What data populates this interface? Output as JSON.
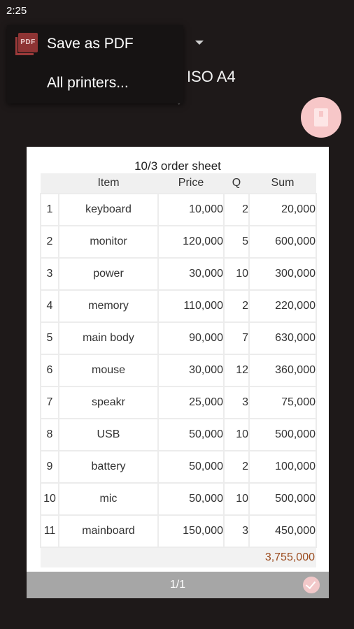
{
  "status_bar": {
    "time": "2:25"
  },
  "print_options": {
    "paper_size": "ISO A4"
  },
  "printer_menu": {
    "items": [
      {
        "label": "Save as PDF",
        "icon": "pdf-icon"
      },
      {
        "label": "All printers..."
      }
    ]
  },
  "fab": {
    "icon": "pdf-download-icon",
    "color": "#f7c7c8"
  },
  "preview": {
    "title": "10/3 order sheet",
    "headers": [
      "",
      "Item",
      "Price",
      "Q",
      "Sum"
    ],
    "rows": [
      [
        "1",
        "keyboard",
        "10,000",
        "2",
        "20,000"
      ],
      [
        "2",
        "monitor",
        "120,000",
        "5",
        "600,000"
      ],
      [
        "3",
        "power",
        "30,000",
        "10",
        "300,000"
      ],
      [
        "4",
        "memory",
        "110,000",
        "2",
        "220,000"
      ],
      [
        "5",
        "main body",
        "90,000",
        "7",
        "630,000"
      ],
      [
        "6",
        "mouse",
        "30,000",
        "12",
        "360,000"
      ],
      [
        "7",
        "speakr",
        "25,000",
        "3",
        "75,000"
      ],
      [
        "8",
        "USB",
        "50,000",
        "10",
        "500,000"
      ],
      [
        "9",
        "battery",
        "50,000",
        "2",
        "100,000"
      ],
      [
        "10",
        "mic",
        "50,000",
        "10",
        "500,000"
      ],
      [
        "11",
        "mainboard",
        "150,000",
        "3",
        "450,000"
      ]
    ],
    "total": "3,755,000",
    "total_color": "#9b4b1e",
    "page_counter": "1/1"
  }
}
